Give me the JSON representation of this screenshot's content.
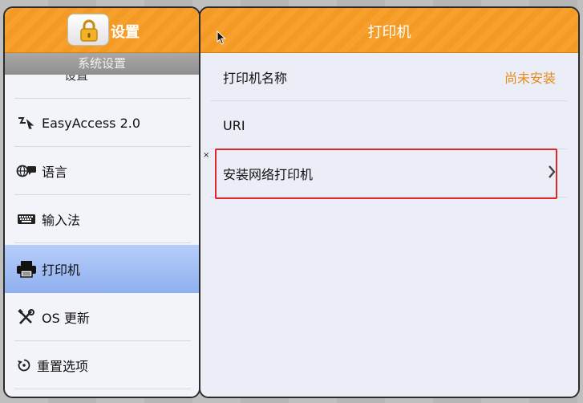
{
  "left": {
    "title": "设置",
    "subtitle": "系统设置",
    "partial_item": "设置",
    "items": [
      {
        "label": "EasyAccess 2.0",
        "icon": "easyaccess-icon"
      },
      {
        "label": "语言",
        "icon": "language-icon"
      },
      {
        "label": "输入法",
        "icon": "keyboard-icon"
      },
      {
        "label": "打印机",
        "icon": "printer-icon",
        "selected": true
      },
      {
        "label": "OS 更新",
        "icon": "tools-icon"
      },
      {
        "label": "重置选项",
        "icon": "reset-icon"
      }
    ]
  },
  "right": {
    "title": "打印机",
    "rows": [
      {
        "label": "打印机名称",
        "value": "尚未安装"
      },
      {
        "label": "URI"
      },
      {
        "label": "安装网络打印机"
      }
    ]
  },
  "colors": {
    "accent": "#f39a25",
    "value_text": "#e88a1a",
    "highlight": "#e0262b",
    "selected": "#8fb0ef"
  }
}
